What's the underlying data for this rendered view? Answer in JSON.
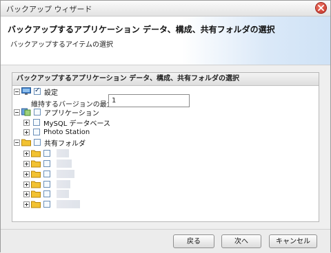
{
  "window": {
    "title": "バックアップ ウィザード"
  },
  "header": {
    "title": "バックアップするアプリケーション データ、構成、共有フォルダの選択",
    "subtitle": "バックアップするアイテムの選択"
  },
  "panel": {
    "title": "バックアップするアプリケーション データ、構成、共有フォルダの選択",
    "settings": {
      "label": "設定",
      "checked": true
    },
    "max_versions": {
      "label": "維持するバージョンの最大数",
      "value": "1"
    },
    "applications": {
      "label": "アプリケーション",
      "items": [
        {
          "label": "MySQL データベース"
        },
        {
          "label": "Photo Station"
        }
      ]
    },
    "shared_folders": {
      "label": "共有フォルダ"
    }
  },
  "footer": {
    "back": "戻る",
    "next": "次へ",
    "cancel": "キャンセル"
  },
  "colors": {
    "header_gradient_end": "#cfe2f6",
    "close_button": "#c0281c",
    "checkbox_border": "#6b8fb7",
    "folder_yellow": "#f2c232"
  }
}
